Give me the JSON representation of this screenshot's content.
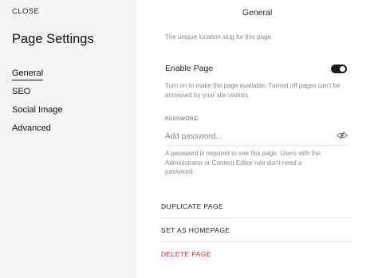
{
  "sidebar": {
    "close_label": "CLOSE",
    "title": "Page Settings",
    "items": [
      {
        "label": "General",
        "active": true
      },
      {
        "label": "SEO"
      },
      {
        "label": "Social Image"
      },
      {
        "label": "Advanced"
      }
    ]
  },
  "main": {
    "header": "General",
    "slug_description": "The unique location slug for this page.",
    "enable_page": {
      "label": "Enable Page",
      "enabled": true,
      "description": "Turn on to make the page available. Turned off pages can't be accessed by your site visitors."
    },
    "password": {
      "label": "PASSWORD",
      "value": "",
      "placeholder": "Add password...",
      "icon": "eye-slash-icon",
      "description": "A password is required to see this page. Users with the Administrator or Content Editor role don't need a password."
    },
    "actions": {
      "duplicate": "DUPLICATE PAGE",
      "set_homepage": "SET AS HOMEPAGE",
      "delete": "DELETE PAGE"
    }
  },
  "colors": {
    "sidebar_bg": "#f5f5f5",
    "danger": "#e0242e",
    "toggle_on": "#1a1a1a"
  }
}
